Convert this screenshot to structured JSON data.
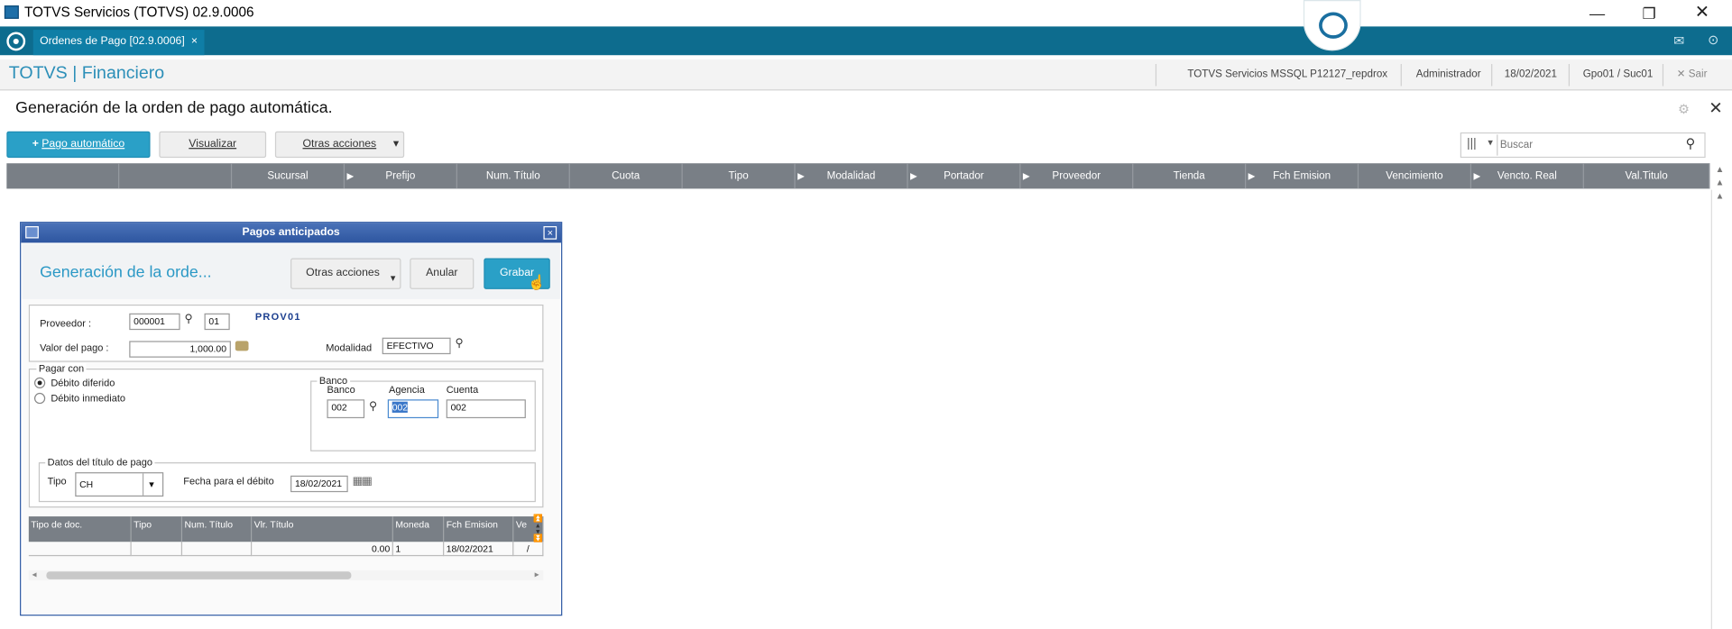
{
  "window": {
    "title": "TOTVS Servicios (TOTVS) 02.9.0006"
  },
  "tabbar": {
    "tab_label": "Ordenes de Pago [02.9.0006]",
    "tab_close": "×"
  },
  "header": {
    "brand": "TOTVS | Financiero",
    "environment": "TOTVS Servicios MSSQL P12127_repdrox",
    "user": "Administrador",
    "date": "18/02/2021",
    "branch": "Gpo01 / Suc01",
    "exit_label": "Sair"
  },
  "page": {
    "title": "Generación de la orden de pago automática."
  },
  "toolbar": {
    "primary_label": "Pago automático",
    "view_label": "Visualizar",
    "other_label": "Otras acciones",
    "search_placeholder": "Buscar"
  },
  "grid": {
    "columns": [
      "",
      "",
      "Sucursal",
      "Prefijo",
      "Num. Título",
      "Cuota",
      "Tipo",
      "Modalidad",
      "Portador",
      "Proveedor",
      "Tienda",
      "Fch Emision",
      "Vencimiento",
      "Vencto. Real",
      "Val.Titulo"
    ]
  },
  "dialog": {
    "title": "Pagos anticipados",
    "heading": "Generación de la orde...",
    "other_label": "Otras acciones",
    "cancel_label": "Anular",
    "save_label": "Grabar",
    "supplier_label": "Proveedor :",
    "supplier_code": "000001",
    "supplier_store": "01",
    "supplier_name": "PROV01",
    "amount_label": "Valor del pago :",
    "amount_value": "1,000.00",
    "modality_label": "Modalidad",
    "modality_value": "EFECTIVO",
    "pay_with_legend": "Pagar con",
    "option_deferred": "Débito diferido",
    "option_immediate": "Débito inmediato",
    "selected_option": "Débito diferido",
    "bank_legend": "Banco",
    "bank_label": "Banco",
    "agency_label": "Agencia",
    "account_label": "Cuenta",
    "bank_value": "002",
    "agency_value": "002",
    "account_value": "002",
    "title_data_legend": "Datos del título de pago",
    "type_label": "Tipo",
    "type_value": "CH",
    "debit_date_label": "Fecha para el débito",
    "debit_date_value": "18/02/2021",
    "table": {
      "columns": [
        "Tipo de doc.",
        "Tipo",
        "Num. Título",
        "Vlr. Título",
        "Moneda",
        "Fch Emision",
        "Ve"
      ],
      "row": [
        "",
        "",
        "",
        "0.00",
        "1",
        "18/02/2021",
        "/"
      ]
    }
  },
  "colors": {
    "accent": "#2aa0c7",
    "tabbar": "#0d6c8e",
    "grid_header": "#797f86",
    "dialog_title": "#2e56a0"
  }
}
